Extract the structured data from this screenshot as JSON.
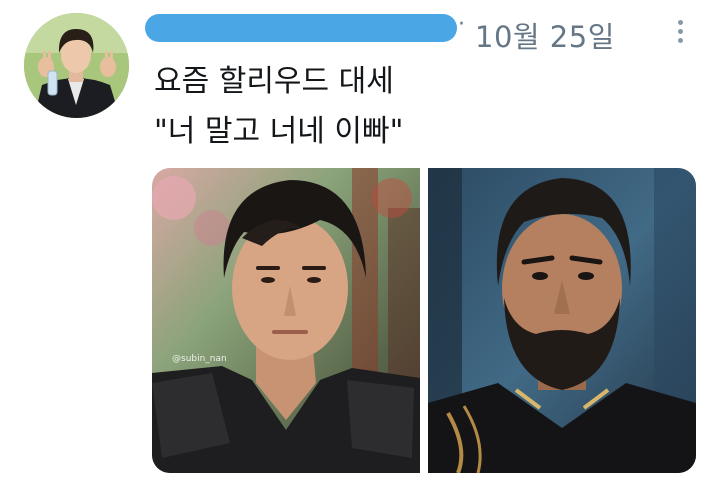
{
  "tweet": {
    "date": "10월 25일",
    "separator": "·",
    "text_lines": [
      "요즘 할리우드 대세",
      "\"너 말고 너네 이빠\""
    ],
    "media": {
      "left_watermark": "@subin_nan"
    }
  },
  "colors": {
    "redaction": "#4aa6e4",
    "secondary_text": "#657786",
    "primary_text": "#14171a"
  }
}
